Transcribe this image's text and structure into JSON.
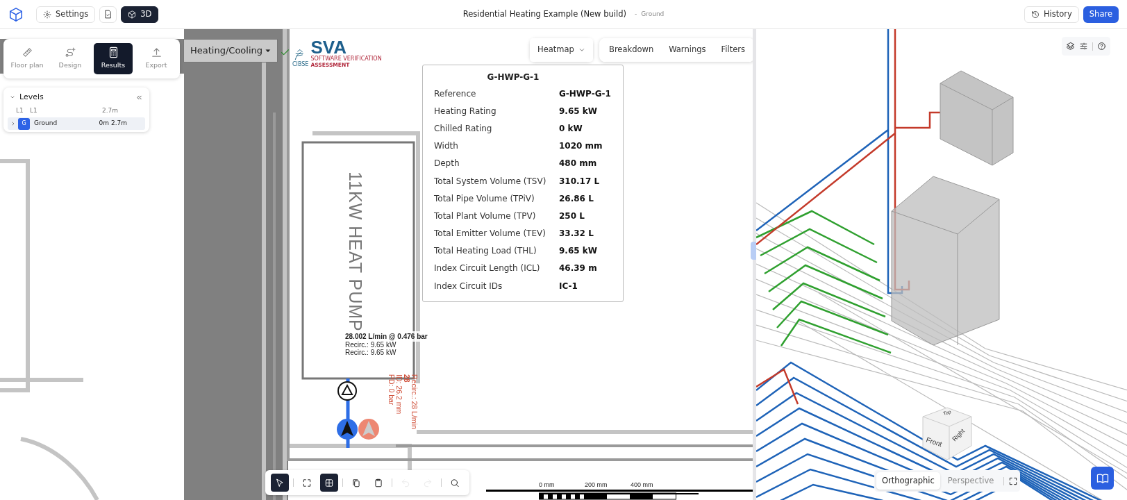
{
  "header": {
    "settings": "Settings",
    "view_3d": {
      "label": "3D",
      "selected": true
    },
    "title": "Residential Heating Example (New build)",
    "separator": "-",
    "level": "Ground",
    "history": "History",
    "share": "Share"
  },
  "mode_tabs": [
    {
      "label": "Floor plan",
      "selected": false
    },
    {
      "label": "Design",
      "selected": false
    },
    {
      "label": "Results",
      "selected": true
    },
    {
      "label": "Export",
      "selected": false
    }
  ],
  "levels": {
    "title": "Levels",
    "rows": [
      {
        "kind": "plain",
        "code": "L1",
        "name": "L1",
        "height": "2.7m",
        "selected": false
      },
      {
        "kind": "badge",
        "code": "G",
        "name": "Ground",
        "floor": "0m",
        "height": "2.7m",
        "selected": true
      }
    ]
  },
  "system_dropdown": "Heating/Cooling",
  "logo": {
    "mark": "SVA",
    "org": "CIBSE",
    "line1": "SOFTWARE VERIFICATION",
    "line2": "ASSESSMENT"
  },
  "results_bar": {
    "heatmap": "Heatmap",
    "buttons": [
      "Breakdown",
      "Warnings",
      "Filters"
    ]
  },
  "info_popup": {
    "title": "G-HWP-G-1",
    "rows": [
      {
        "label": "Reference",
        "value": "G-HWP-G-1"
      },
      {
        "label": "Heating Rating",
        "value": "9.65 kW"
      },
      {
        "label": "Chilled Rating",
        "value": "0 kW"
      },
      {
        "label": "Width",
        "value": "1020 mm"
      },
      {
        "label": "Depth",
        "value": "480 mm"
      },
      {
        "label": "Total System Volume (TSV)",
        "value": "310.17 L"
      },
      {
        "label": "Total Pipe Volume (TPiV)",
        "value": "26.86 L"
      },
      {
        "label": "Total Plant Volume (TPV)",
        "value": "250 L"
      },
      {
        "label": "Total Emitter Volume (TEV)",
        "value": "33.32 L"
      },
      {
        "label": "Total Heating Load (THL)",
        "value": "9.65 kW"
      },
      {
        "label": "Index Circuit Length (ICL)",
        "value": "46.39 m"
      },
      {
        "label": "Index Circuit IDs",
        "value": "IC-1"
      }
    ]
  },
  "plan_labels": {
    "equipment": "11KW HEAT PUMP",
    "flow": "28.002 L/min @ 0.476 bar",
    "recirc": [
      "Recirc.: 9.65 kW",
      "Recirc.: 9.65 kW"
    ],
    "return_lines": [
      "Recirc.: 28 L/min",
      "28",
      "ID: 26.2 mm",
      "PD: 0 bar"
    ]
  },
  "canvas_tools": [
    {
      "kind": "select",
      "selected": true,
      "disabled": false
    },
    {
      "kind": "fit",
      "selected": false,
      "disabled": false
    },
    {
      "kind": "grid",
      "selected": true,
      "disabled": false
    },
    {
      "kind": "copy",
      "selected": false,
      "disabled": false
    },
    {
      "kind": "paste",
      "selected": false,
      "disabled": false
    },
    {
      "kind": "undo",
      "selected": false,
      "disabled": true
    },
    {
      "kind": "redo",
      "selected": false,
      "disabled": true
    },
    {
      "kind": "search",
      "selected": false,
      "disabled": false
    }
  ],
  "scale_bar": [
    "0 mm",
    "200 mm",
    "400 mm"
  ],
  "view3d": {
    "cube_faces": [
      "Top",
      "Front",
      "Right"
    ],
    "projections": [
      {
        "label": "Orthographic",
        "selected": true
      },
      {
        "label": "Perspective",
        "selected": false
      }
    ]
  }
}
